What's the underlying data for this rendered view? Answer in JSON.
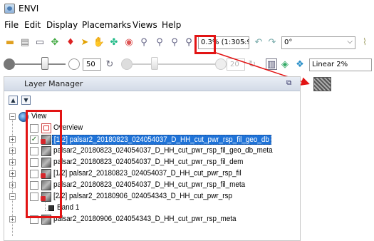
{
  "window": {
    "title": "ENVI"
  },
  "menu": [
    "File",
    "Edit",
    "Display",
    "Placemarks",
    "Views",
    "Help"
  ],
  "toolbar1": {
    "zoom_value": "0.3% (1:305.9",
    "rotation_value": "0°"
  },
  "toolbar2": {
    "brightness_value": "50",
    "transparency_value": "20",
    "stretch_value": "Linear 2%"
  },
  "layer_manager": {
    "title": "Layer Manager",
    "root": "View",
    "items": [
      {
        "label": "Overview",
        "checked": false
      },
      {
        "label": "[1/2] palsar2_20180823_024054037_D_HH_cut_pwr_rsp_fil_geo_db",
        "checked": true,
        "selected": true
      },
      {
        "label": "palsar2_20180823_024054037_D_HH_cut_pwr_rsp_fil_geo_db_meta",
        "checked": false
      },
      {
        "label": "palsar2_20180823_024054037_D_HH_cut_pwr_rsp_fil_dem",
        "checked": false
      },
      {
        "label": "[1/2] palsar2_20180823_024054037_D_HH_cut_pwr_rsp_fil",
        "checked": false
      },
      {
        "label": "palsar2_20180823_024054037_D_HH_cut_pwr_rsp_fil_meta",
        "checked": false
      },
      {
        "label": "[2/2] palsar2_20180906_024054343_D_HH_cut_pwr_rsp",
        "checked": false
      },
      {
        "label": "Band 1"
      },
      {
        "label": "palsar2_20180906_024054343_D_HH_cut_pwr_rsp_meta",
        "checked": false
      }
    ]
  },
  "colors": {
    "highlight": "#e21414",
    "selection": "#1f73d8"
  }
}
